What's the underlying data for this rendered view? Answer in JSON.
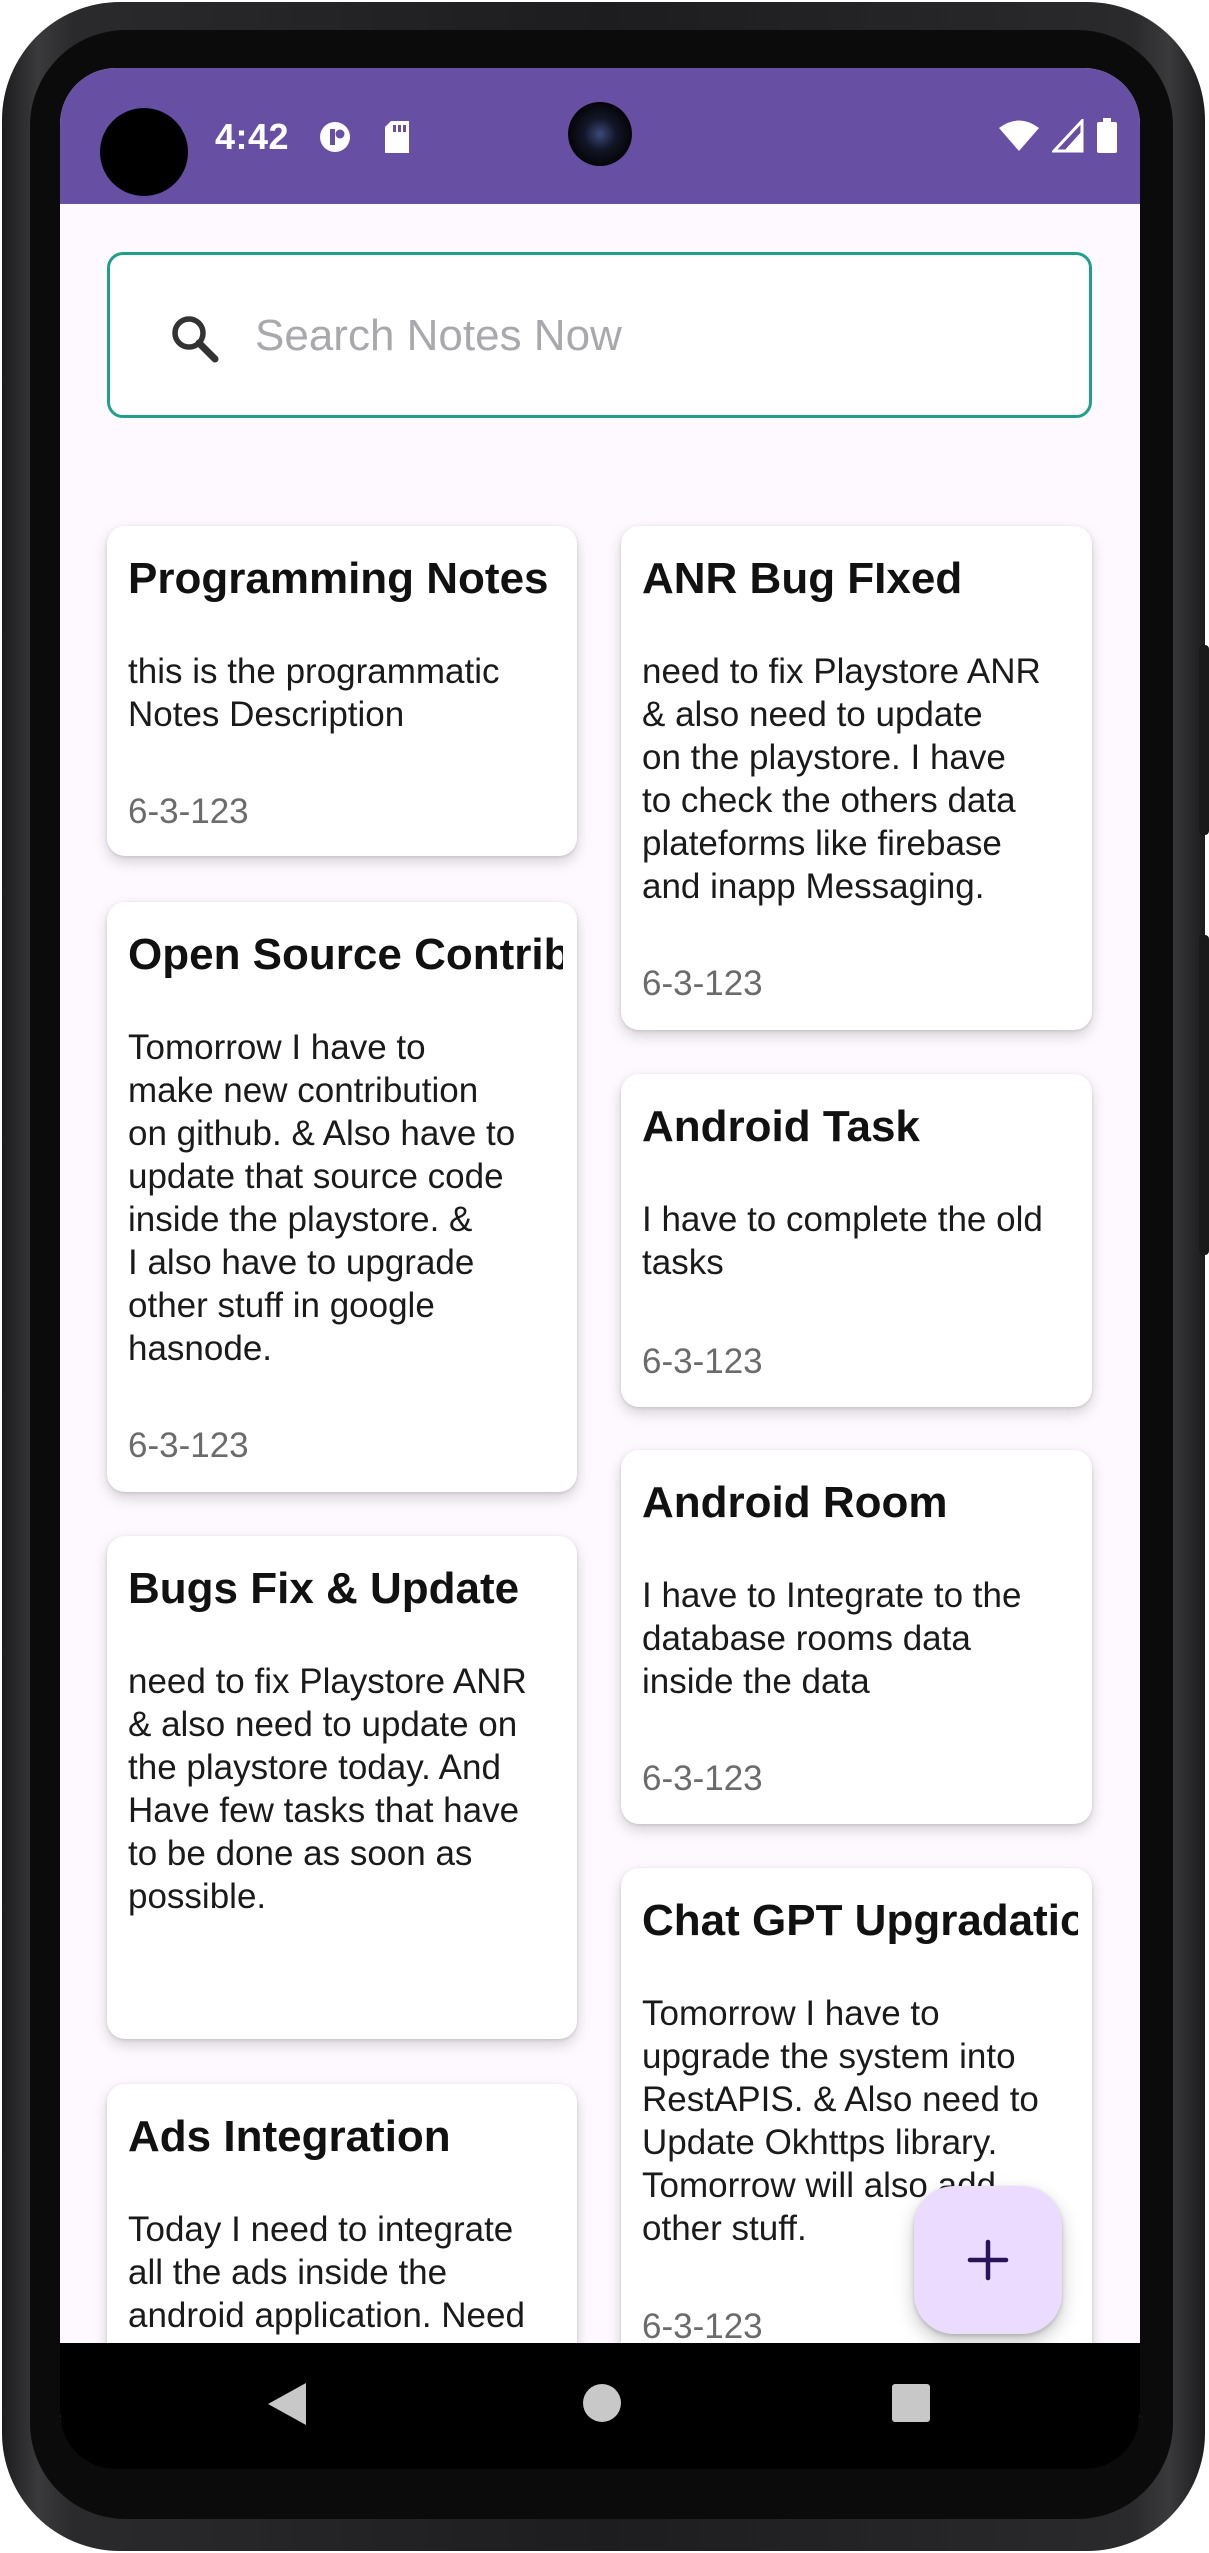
{
  "status_bar": {
    "time": "4:42",
    "color": "#6750a4"
  },
  "search": {
    "placeholder": "Search Notes Now",
    "value": ""
  },
  "notes": {
    "left": [
      {
        "title": "Programming Notes",
        "description": "this is the programmatic\nNotes Description",
        "date": "6-3-123"
      },
      {
        "title": "Open Source Contribution",
        "description": "Tomorrow I have to\nmake new contribution\non github. & Also have to\nupdate that source code\ninside the playstore. &\nI also have to upgrade\nother stuff in google\nhasnode.",
        "date": "6-3-123"
      },
      {
        "title": "Bugs Fix & Update",
        "description": "need to fix Playstore ANR\n& also need to update on\nthe playstore today. And\nHave few tasks that have\nto be done as soon as\npossible.",
        "date": ""
      },
      {
        "title": "Ads Integration",
        "description": "Today  I need to integrate\nall the ads inside the\nandroid application. Need\nto Implement all the Ads,",
        "date": ""
      }
    ],
    "right": [
      {
        "title": "ANR Bug FIxed",
        "description": "need to fix Playstore ANR\n& also need to update\non the playstore. I have\nto check the others data\nplateforms like firebase\nand inapp Messaging.",
        "date": "6-3-123"
      },
      {
        "title": "Android Task",
        "description": "I have to complete the old\ntasks",
        "date": "6-3-123"
      },
      {
        "title": "Android Room",
        "description": "I have to Integrate to the\ndatabase rooms data\ninside the data",
        "date": "6-3-123"
      },
      {
        "title": "Chat GPT Upgradation",
        "description": " Tomorrow I have to\nupgrade the system into\nRestAPIS. & Also need to\nUpdate Okhttps library.\nTomorrow will also add\nother stuff.",
        "date": "6-3-123"
      }
    ]
  },
  "fab": {
    "icon": "plus-icon",
    "label": "+"
  },
  "colors": {
    "accent": "#6750a4",
    "search_border": "#20a08a",
    "fab_background": "#ebdcff",
    "fab_icon": "#2a1458"
  }
}
